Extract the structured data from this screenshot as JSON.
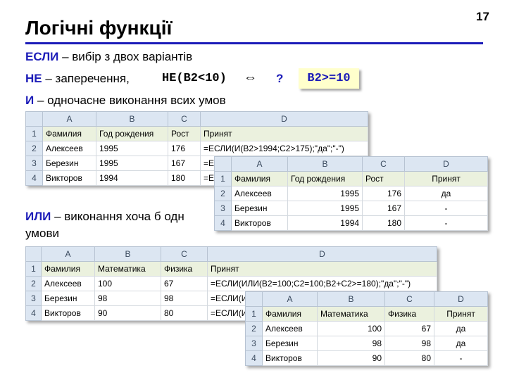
{
  "slide": {
    "title": "Логічні функції",
    "page_number": "17"
  },
  "text": {
    "esli_kw": "ЕСЛИ",
    "esli_desc": " – вибір з двох варіантів",
    "ne_kw": "НЕ",
    "ne_desc": " – заперечення,",
    "ne_code": "НЕ(B2<10)",
    "equiv_sym": "⇔",
    "question": "?",
    "answer_code": "B2>=10",
    "i_kw": "И",
    "i_desc": " – одночасне виконання всих умов",
    "ili_kw": "ИЛИ",
    "ili_desc": " – виконання хоча б одн",
    "ili_desc2": "умови"
  },
  "tables": {
    "t1": {
      "cols": [
        "A",
        "B",
        "C",
        "D"
      ],
      "rows": [
        [
          "1",
          "Фамилия",
          "Год рождения",
          "Рост",
          "Принят"
        ],
        [
          "2",
          "Алексеев",
          "1995",
          "176",
          "=ЕСЛИ(И(B2>1994;C2>175);\"да\";\"-\")"
        ],
        [
          "3",
          "Березин",
          "1995",
          "167",
          "=Е"
        ],
        [
          "4",
          "Викторов",
          "1994",
          "180",
          "=Е"
        ]
      ]
    },
    "t2": {
      "cols": [
        "A",
        "B",
        "C",
        "D"
      ],
      "rows": [
        [
          "1",
          "Фамилия",
          "Год рождения",
          "Рост",
          "Принят"
        ],
        [
          "2",
          "Алексеев",
          "1995",
          "176",
          "да"
        ],
        [
          "3",
          "Березин",
          "1995",
          "167",
          "-"
        ],
        [
          "4",
          "Викторов",
          "1994",
          "180",
          "-"
        ]
      ]
    },
    "t3": {
      "cols": [
        "A",
        "B",
        "C",
        "D"
      ],
      "rows": [
        [
          "1",
          "Фамилия",
          "Математика",
          "Физика",
          "Принят"
        ],
        [
          "2",
          "Алексеев",
          "100",
          "67",
          "=ЕСЛИ(ИЛИ(B2=100;C2=100;B2+C2>=180);\"да\";\"-\")"
        ],
        [
          "3",
          "Березин",
          "98",
          "98",
          "=ЕСЛИ(И"
        ],
        [
          "4",
          "Викторов",
          "90",
          "80",
          "=ЕСЛИ(И"
        ]
      ]
    },
    "t4": {
      "cols": [
        "A",
        "B",
        "C",
        "D"
      ],
      "rows": [
        [
          "1",
          "Фамилия",
          "Математика",
          "Физика",
          "Принят"
        ],
        [
          "2",
          "Алексеев",
          "100",
          "67",
          "да"
        ],
        [
          "3",
          "Березин",
          "98",
          "98",
          "да"
        ],
        [
          "4",
          "Викторов",
          "90",
          "80",
          "-"
        ]
      ]
    }
  }
}
